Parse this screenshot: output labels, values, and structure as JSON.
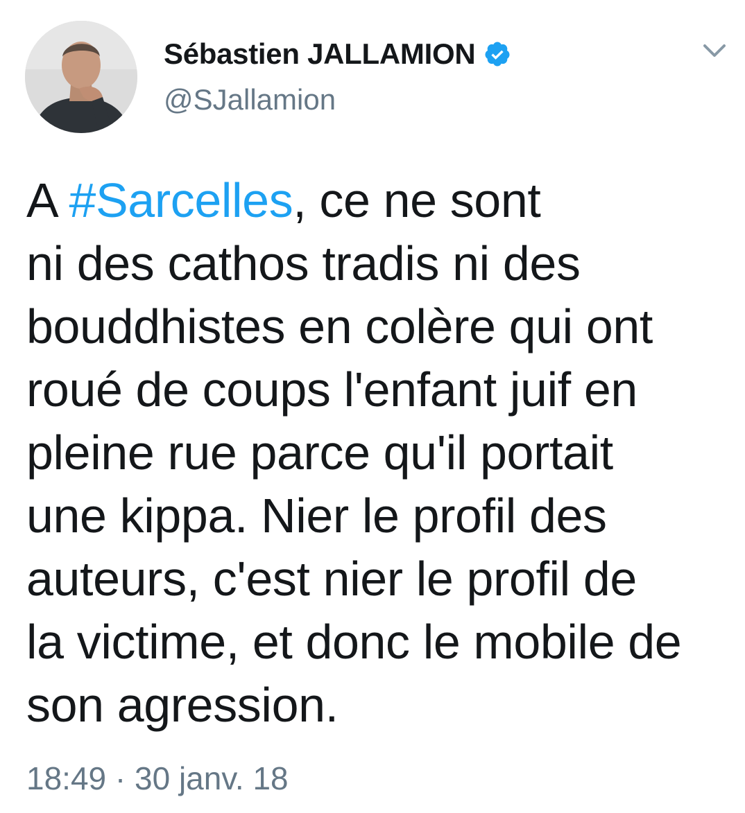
{
  "author": {
    "display_name": "Sébastien JALLAMION",
    "handle": "@SJallamion",
    "verified": true,
    "avatar_icon": "profile-photo",
    "verified_icon": "verified-badge-icon",
    "verified_color": "#1da1f2"
  },
  "menu": {
    "icon": "chevron-down-icon"
  },
  "tweet": {
    "lines": [
      {
        "prefix": "A ",
        "hashtag": "#Sarcelles",
        "suffix": ", ce ne sont"
      },
      {
        "text": "ni des cathos tradis ni des"
      },
      {
        "text": "bouddhistes en colère qui ont"
      },
      {
        "text": "roué de coups l'enfant juif en"
      },
      {
        "text": "pleine rue parce qu'il portait"
      },
      {
        "text": "une kippa. Nier le profil des"
      },
      {
        "text": "auteurs, c'est nier le profil de"
      },
      {
        "text": "la victime, et donc le mobile de"
      },
      {
        "text": "son agression."
      }
    ],
    "hashtag_color": "#1da1f2",
    "timestamp": "18:49 · 30 janv. 18"
  }
}
